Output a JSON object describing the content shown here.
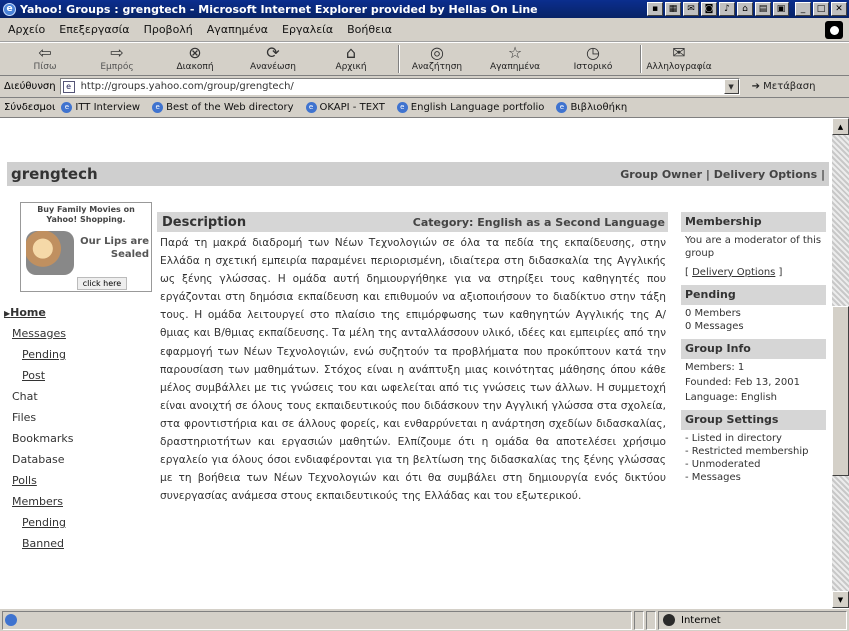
{
  "window": {
    "title": "Yahoo! Groups : grengtech - Microsoft Internet Explorer provided by Hellas On Line",
    "title_icons": [
      "MS",
      "cal",
      "msg",
      "cam",
      "vol",
      "net",
      "prn",
      "img",
      "min",
      "max",
      "close"
    ]
  },
  "menu": [
    "Αρχείο",
    "Επεξεργασία",
    "Προβολή",
    "Αγαπημένα",
    "Εργαλεία",
    "Βοήθεια"
  ],
  "toolbar": [
    {
      "icon": "back-arrow-icon",
      "glyph": "⇦",
      "label": "Πίσω"
    },
    {
      "icon": "forward-arrow-icon",
      "glyph": "⇨",
      "label": "Εμπρός"
    },
    {
      "icon": "stop-icon",
      "glyph": "⊗",
      "label": "Διακοπή"
    },
    {
      "icon": "refresh-icon",
      "glyph": "⟳",
      "label": "Ανανέωση"
    },
    {
      "icon": "home-icon",
      "glyph": "⌂",
      "label": "Αρχική"
    },
    {
      "icon": "search-icon",
      "glyph": "◎",
      "label": "Αναζήτηση"
    },
    {
      "icon": "favorites-icon",
      "glyph": "☆",
      "label": "Αγαπημένα"
    },
    {
      "icon": "history-icon",
      "glyph": "◷",
      "label": "Ιστορικό"
    },
    {
      "icon": "mail-icon",
      "glyph": "✉",
      "label": "Αλληλογραφία"
    }
  ],
  "address": {
    "label": "Διεύθυνση",
    "url": "http://groups.yahoo.com/group/grengtech/",
    "go": "Μετάβαση"
  },
  "links": {
    "label": "Σύνδεσμοι",
    "items": [
      "ITT Interview",
      "Best of the Web directory",
      "OKAPI - TEXT",
      "English Language portfolio",
      "Βιβλιοθήκη"
    ]
  },
  "page": {
    "group_name": "grengtech",
    "group_owner": "Group Owner",
    "delivery_options": "Delivery Options",
    "ad": {
      "title": "Buy Family Movies on Yahoo! Shopping.",
      "text": "Our Lips are Sealed",
      "click": "click here"
    },
    "nav": [
      {
        "label": "Home",
        "level": "home",
        "link": true
      },
      {
        "label": "Messages",
        "level": "l1",
        "link": true
      },
      {
        "label": "Pending",
        "level": "l2",
        "link": true
      },
      {
        "label": "Post",
        "level": "l2",
        "link": true
      },
      {
        "label": "Chat",
        "level": "l1",
        "link": false
      },
      {
        "label": "Files",
        "level": "l1",
        "link": false
      },
      {
        "label": "Bookmarks",
        "level": "l1",
        "link": false
      },
      {
        "label": "Database",
        "level": "l1",
        "link": false
      },
      {
        "label": "Polls",
        "level": "l1",
        "link": true
      },
      {
        "label": "Members",
        "level": "l1",
        "link": true
      },
      {
        "label": "Pending",
        "level": "l2",
        "link": true
      },
      {
        "label": "Banned",
        "level": "l2",
        "link": true
      }
    ],
    "description_title": "Description",
    "category": "Category: English as a Second Language",
    "description": "Παρά τη μακρά διαδρομή των Νέων Τεχνολογιών σε όλα τα πεδία της εκπαίδευσης, στην Ελλάδα η σχετική εμπειρία παραμένει περιορισμένη, ιδιαίτερα στη διδασκαλία της Αγγλικής ως ξένης γλώσσας. Η ομάδα αυτή δημιουργήθηκε για να στηρίξει τους καθηγητές που εργάζονται στη δημόσια εκπαίδευση και επιθυμούν να αξιοποιήσουν το διαδίκτυο στην τάξη τους. Η ομάδα λειτουργεί στο πλαίσιο της επιμόρφωσης των καθηγητών Αγγλικής της Α/θμιας και Β/θμιας εκπαίδευσης. Τα μέλη της ανταλλάσσουν υλικό, ιδέες και εμπειρίες από την εφαρμογή των Νέων Τεχνολογιών, ενώ συζητούν τα προβλήματα που προκύπτουν κατά την παρουσίαση των μαθημάτων. Στόχος είναι η ανάπτυξη μιας κοινότητας μάθησης όπου κάθε μέλος συμβάλλει με τις γνώσεις του και ωφελείται από τις γνώσεις των άλλων. Η συμμετοχή είναι ανοιχτή σε όλους τους εκπαιδευτικούς που διδάσκουν την Αγγλική γλώσσα στα σχολεία, στα φροντιστήρια και σε άλλους φορείς, και ενθαρρύνεται η ανάρτηση σχεδίων διδασκαλίας, δραστηριοτήτων και εργασιών μαθητών. Ελπίζουμε ότι η ομάδα θα αποτελέσει χρήσιμο εργαλείο για όλους όσοι ενδιαφέρονται για τη βελτίωση της διδασκαλίας της ξένης γλώσσας με τη βοήθεια των Νέων Τεχνολογιών και ότι θα συμβάλει στη δημιουργία ενός δικτύου συνεργασίας ανάμεσα στους εκπαιδευτικούς της Ελλάδας και του εξωτερικού.",
    "right": {
      "membership_head": "Membership",
      "membership_text": "You are a moderator of this group",
      "delivery_link": "Delivery Options",
      "pending_head": "Pending",
      "pending_items": [
        "0 Members",
        "0 Messages"
      ],
      "info_head": "Group Info",
      "members": "Members: 1",
      "founded": "Founded: Feb 13, 2001",
      "language": "Language: English",
      "settings_head": "Group Settings",
      "settings_items": [
        "- Listed in directory",
        "- Restricted membership",
        "- Unmoderated",
        "- Messages"
      ]
    }
  },
  "status": {
    "left": "",
    "zone": "Internet"
  }
}
